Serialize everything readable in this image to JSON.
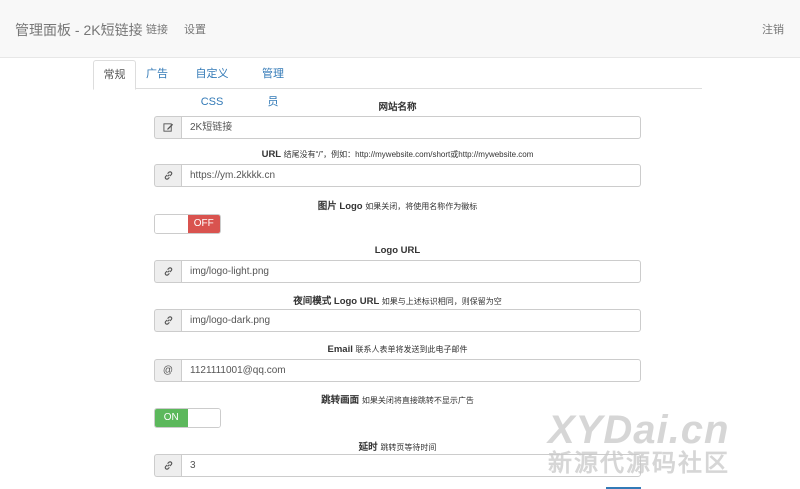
{
  "navbar": {
    "brand": "管理面板 - 2K短链接",
    "links_label": "链接",
    "settings_label": "设置",
    "logout_label": "注销"
  },
  "tabs": [
    {
      "label": "常规",
      "active": true
    },
    {
      "label": "广告",
      "active": false
    },
    {
      "label": "自定义CSS",
      "active": false
    },
    {
      "label": "管理员",
      "active": false
    }
  ],
  "fields": {
    "site_name": {
      "label": "网站名称",
      "value": "2K短链接",
      "icon": "edit-icon"
    },
    "url": {
      "label": "URL",
      "hint": "结尾没有“/”，例如：http://mywebsite.com/short或http://mywebsite.com",
      "value": "https://ym.2kkkk.cn",
      "icon": "link-icon"
    },
    "image_logo": {
      "label": "图片 Logo",
      "hint": "如果关闭，将使用名称作为徽标",
      "state": "OFF"
    },
    "logo_url": {
      "label": "Logo URL",
      "value": "img/logo-light.png",
      "icon": "link-icon"
    },
    "dark_logo_url": {
      "label": "夜间模式 Logo URL",
      "hint": "如果与上述标识相同，则保留为空",
      "value": "img/logo-dark.png",
      "icon": "link-icon"
    },
    "email": {
      "label": "Email",
      "hint": "联系人表单将发送到此电子邮件",
      "value": "1121111001@qq.com",
      "icon": "at-icon"
    },
    "redirect_page": {
      "label": "跳转画面",
      "hint": "如果关闭将直接跳转不显示广告",
      "state": "ON"
    },
    "delay": {
      "label": "延时",
      "hint": "跳转页等待时间",
      "value": "3",
      "icon": "link-icon"
    }
  },
  "watermark": {
    "main": "XYDai.cn",
    "sub": "新源代源码社区"
  }
}
